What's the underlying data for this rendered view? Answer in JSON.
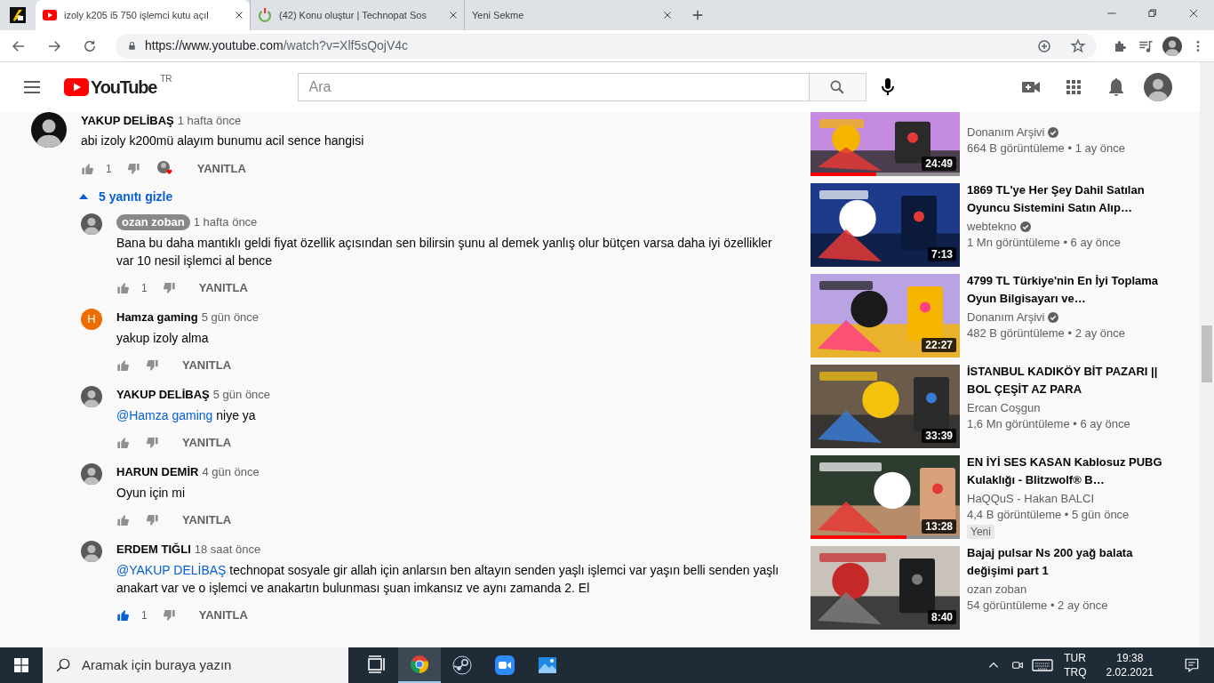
{
  "browser": {
    "tabs": [
      {
        "kind": "pinned",
        "selected": false
      },
      {
        "kind": "youtube",
        "title": "izoly k205 i5 750 işlemci kutu açıl",
        "selected": true
      },
      {
        "kind": "power",
        "title": "(42) Konu oluştur | Technopat Sos",
        "selected": false
      },
      {
        "kind": "blank",
        "title": "Yeni Sekme",
        "selected": false
      }
    ],
    "url": "https://www.youtube.com/watch?v=Xlf5sQojV4c"
  },
  "header": {
    "logo": "YouTube",
    "region": "TR",
    "search_placeholder": "Ara"
  },
  "comment": {
    "author": "YAKUP DELİBAŞ",
    "time": "1 hafta önce",
    "text": "abi izoly k200mü alayım bunumu acil sence hangisi",
    "likes": "1",
    "liked": false,
    "hearted": true,
    "reply_label": "YANITLA",
    "replies_toggle": {
      "label": "5 yanıtı gizle",
      "expanded": true
    }
  },
  "replies": [
    {
      "author": "ozan zoban",
      "owner": true,
      "time": "1 hafta önce",
      "text": "Bana bu daha mantıklı geldi fiyat özellik açısından sen bilirsin şunu al demek yanlış olur bütçen varsa daha iyi özellikler var 10 nesil işlemci al bence",
      "likes": "1",
      "liked": false,
      "reply_label": "YANITLA"
    },
    {
      "author": "Hamza gaming",
      "owner": false,
      "time": "5 gün önce",
      "text": "yakup izoly alma",
      "liked": false,
      "reply_label": "YANITLA",
      "avatar": {
        "kind": "letter",
        "letter": "H"
      }
    },
    {
      "author": "YAKUP DELİBAŞ",
      "owner": false,
      "time": "5 gün önce",
      "mention": "@Hamza gaming",
      "text": " niye ya",
      "liked": false,
      "reply_label": "YANITLA"
    },
    {
      "author": "HARUN DEMİR",
      "owner": false,
      "time": "4 gün önce",
      "text": "Oyun için mi",
      "liked": false,
      "reply_label": "YANITLA"
    },
    {
      "author": "ERDEM TIĞLI",
      "owner": false,
      "time": "18 saat önce",
      "mention": "@YAKUP DELİBAŞ",
      "text": " technopat sosyale gir allah için anlarsın ben altayın senden yaşlı işlemci var yaşın belli senden yaşlı anakart var ve o işlemci ve anakartın bulunması şuan imkansız ve aynı zamanda 2. El",
      "likes": "1",
      "liked": true,
      "reply_label": "YANITLA"
    }
  ],
  "sidebar": [
    {
      "partial": true,
      "channel": "Donanım Arşivi",
      "verified": true,
      "meta": "664 B görüntüleme • 1 ay önce",
      "duration": "24:49",
      "level": 0.44
    },
    {
      "title": "1869 TL'ye Her Şey Dahil Satılan Oyuncu Sistemini Satın Alıp…",
      "channel": "webtekno",
      "verified": true,
      "meta": "1 Mn görüntüleme • 6 ay önce",
      "duration": "7:13"
    },
    {
      "title": "4799 TL Türkiye'nin En İyi Toplama Oyun Bilgisayarı ve…",
      "channel": "Donanım Arşivi",
      "verified": true,
      "meta": "482 B görüntüleme • 2 ay önce",
      "duration": "22:27"
    },
    {
      "title": "İSTANBUL KADIKÖY BİT PAZARI || BOL ÇEŞİT AZ PARA",
      "channel": "Ercan Coşgun",
      "verified": false,
      "meta": "1,6 Mn görüntüleme • 6 ay önce",
      "duration": "33:39"
    },
    {
      "title": "EN İYİ SES KASAN Kablosuz PUBG Kulaklığı - Blitzwolf® B…",
      "channel": "HaQQuS - Hakan BALCI",
      "verified": false,
      "meta": "4,4 B görüntüleme • 5 gün önce",
      "duration": "13:28",
      "level": 0.64,
      "badge": "Yeni"
    },
    {
      "title": "Bajaj pulsar Ns 200 yağ balata değişimi part 1",
      "channel": "ozan zoban",
      "verified": false,
      "meta": "54 görüntüleme • 2 ay önce",
      "duration": "8:40"
    }
  ],
  "taskbar": {
    "search_placeholder": "Aramak için buraya yazın",
    "apps": [
      {
        "kind": "taskview",
        "selected": false
      },
      {
        "kind": "chrome",
        "selected": true
      },
      {
        "kind": "steam",
        "selected": false
      },
      {
        "kind": "zoom",
        "selected": false
      },
      {
        "kind": "photos",
        "selected": false
      }
    ],
    "language": "TUR",
    "layout": "TRQ",
    "time": "19:38",
    "date": "2.02.2021"
  }
}
